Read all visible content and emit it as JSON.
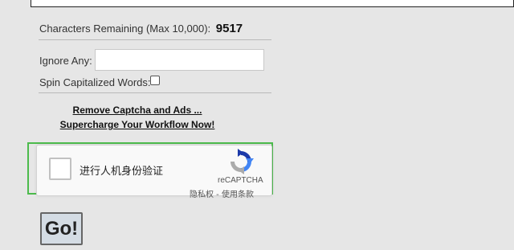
{
  "characters": {
    "label": "Characters Remaining (Max 10,000):",
    "count": "9517"
  },
  "ignore": {
    "label": "Ignore Any:",
    "value": ""
  },
  "spin": {
    "label": "Spin Capitalized Words:",
    "checked": false
  },
  "promo": {
    "line1": "Remove Captcha and Ads ...",
    "line2": "Supercharge Your Workflow Now!"
  },
  "captcha": {
    "label": "进行人机身份验证",
    "brand": "reCAPTCHA",
    "privacy": "隐私权",
    "separator": " - ",
    "terms": "使用条款",
    "highlight_color": "#4cbb4c",
    "logo_icon": "recaptcha-logo-icon"
  },
  "go_button": {
    "label": "Go!"
  }
}
